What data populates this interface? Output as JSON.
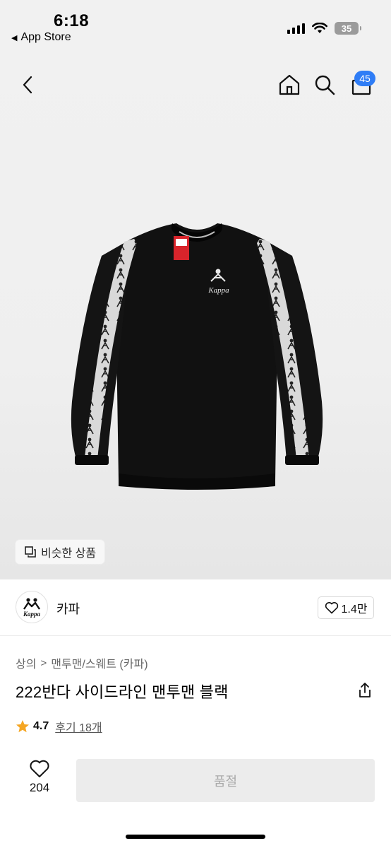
{
  "status_bar": {
    "time": "6:18",
    "back_label": "App Store",
    "battery": "35"
  },
  "nav": {
    "cart_count": "45",
    "accent_color": "#2f7df6"
  },
  "product_image": {
    "brand_mark": "Kappa",
    "sleeve_tape_text": "Kappa"
  },
  "similar_chip": {
    "label": "비슷한 상품"
  },
  "brand": {
    "logo_text": "Kappa",
    "name": "카파",
    "like_count": "1.4만"
  },
  "product": {
    "breadcrumb": [
      "상의",
      "맨투맨/스웨트 (카파)"
    ],
    "title": "222반다 사이드라인 맨투맨 블랙",
    "rating": "4.7",
    "review_label": "후기 18개"
  },
  "purchase_bar": {
    "wish_count": "204",
    "buy_label": "품절"
  }
}
